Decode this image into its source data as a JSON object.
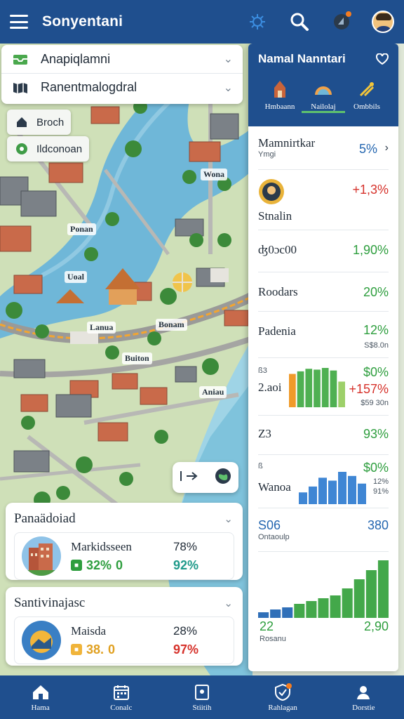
{
  "app": {
    "title": "Sonyentani"
  },
  "colors": {
    "primary": "#1f4f8e",
    "positive": "#2e9e3e",
    "negative": "#d6322b",
    "accent": "#2466b0"
  },
  "topbar": {
    "icons": [
      "menu-icon",
      "network-icon",
      "search-icon",
      "notification-icon",
      "profile-avatar"
    ]
  },
  "search": {
    "origin": "Anapiqlamni",
    "destination": "Ranentmalogdral"
  },
  "layers": [
    {
      "label": "Broch",
      "icon": "home-icon"
    },
    {
      "label": "Ildconoan",
      "icon": "location-icon"
    }
  ],
  "map_labels": [
    "Wona",
    "Ponan",
    "Uoal",
    "Lanua",
    "Bonam",
    "Buiton",
    "Aniau"
  ],
  "cards": [
    {
      "title": "Panaädoiad",
      "name": "Markidsseen",
      "value": "32%",
      "value_suffix": "0",
      "pct1": "78%",
      "pct2": "92%"
    },
    {
      "title": "Santivinajasc",
      "name": "Maisda",
      "value": "38.",
      "value_suffix": "0",
      "pct1": "28%",
      "pct2": "97%"
    }
  ],
  "panel": {
    "title": "Namal Nanntari",
    "tabs": [
      {
        "label": "Hmbaann",
        "icon": "landmark-icon"
      },
      {
        "label": "Nailolaj",
        "icon": "dome-icon"
      },
      {
        "label": "Ombbils",
        "icon": "chart-icon"
      }
    ],
    "rows": [
      {
        "label": "Mamnirtkar",
        "sub": "Ymgi",
        "value": "5%"
      },
      {
        "label": "Stnalin",
        "value": "+1,3%"
      },
      {
        "label": "ʤ0ɔc00",
        "value": "1,90%"
      },
      {
        "label": "Roodars",
        "value": "20%"
      },
      {
        "label": "Padenia",
        "value": "12%",
        "sub": "S$8.0n"
      },
      {
        "label": "2.aoi",
        "pre": "ß3",
        "value1": "$0%",
        "value2": "+157%",
        "sub": "$59 30n"
      },
      {
        "label": "Z3",
        "value": "93%"
      },
      {
        "label": "Wanoa",
        "pre": "ß",
        "value1": "$0%",
        "value2": "12%",
        "value3": "91%"
      },
      {
        "label": "Ontaoulp",
        "left": "S06",
        "value": "380"
      },
      {
        "label": "Rosanu",
        "left": "22",
        "value": "2,90"
      }
    ],
    "bars1": [
      78,
      84,
      90,
      88,
      92,
      86,
      60
    ],
    "bars2": [
      20,
      30,
      45,
      40,
      55,
      48,
      35
    ],
    "bars3": [
      8,
      12,
      15,
      20,
      24,
      28,
      32,
      42,
      55,
      68,
      82
    ]
  },
  "bottomnav": [
    {
      "label": "Hama",
      "icon": "home-icon"
    },
    {
      "label": "Conalc",
      "icon": "calendar-icon"
    },
    {
      "label": "Stiitih",
      "icon": "document-icon"
    },
    {
      "label": "Rahlagan",
      "icon": "shield-icon"
    },
    {
      "label": "Dorstie",
      "icon": "user-icon"
    }
  ]
}
